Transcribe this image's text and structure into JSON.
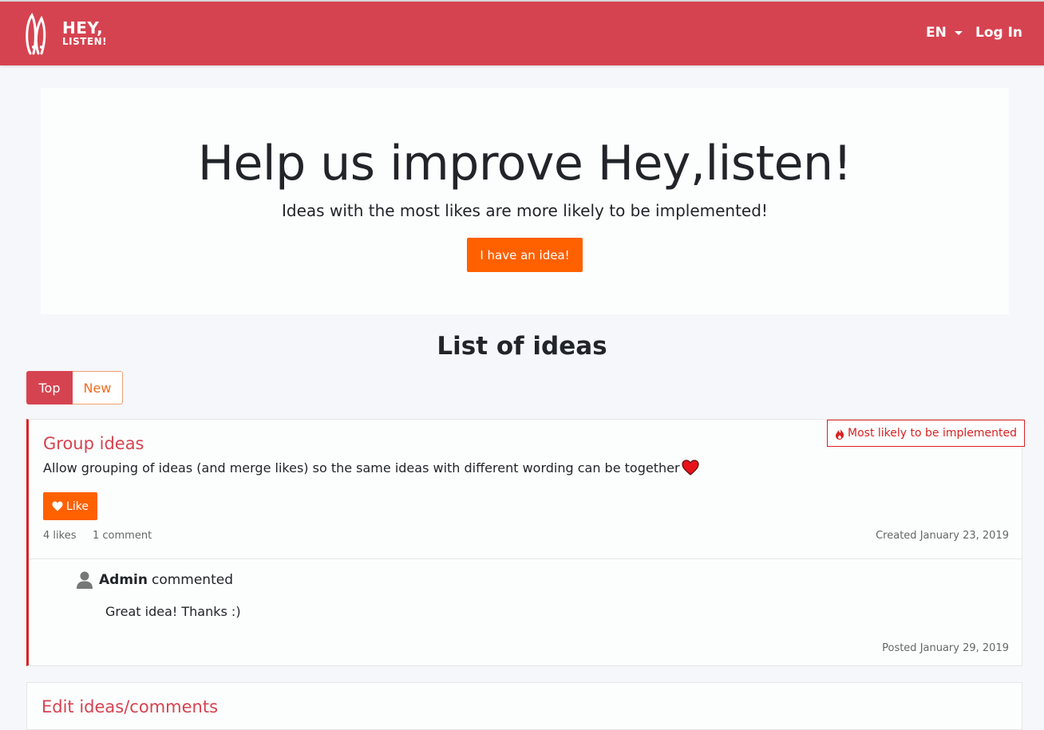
{
  "navbar": {
    "logo_line1": "HEY,",
    "logo_line2": "LISTEN!",
    "language": "EN",
    "login": "Log In",
    "bg_color": "#d64350"
  },
  "hero": {
    "title": "Help us improve Hey,listen!",
    "subtitle": "Ideas with the most likes are more likely to be implemented!",
    "cta": "I have an idea!"
  },
  "list": {
    "title": "List of ideas",
    "tabs": [
      {
        "label": "Top",
        "active": true
      },
      {
        "label": "New",
        "active": false
      }
    ]
  },
  "ideas": [
    {
      "badge": "Most likely to be implemented",
      "title": "Group ideas",
      "description": "Allow grouping of ideas (and merge likes) so the same ideas with different wording can be together",
      "description_emoji": "heart",
      "like_label": "Like",
      "likes": "4 likes",
      "comments": "1 comment",
      "created": "Created January 23, 2019",
      "comment": {
        "author": "Admin",
        "action": "commented",
        "body": "Great idea! Thanks :)",
        "posted": "Posted January 29, 2019"
      }
    },
    {
      "title": "Edit ideas/comments"
    }
  ],
  "colors": {
    "accent": "#d64350",
    "orange": "#ff6000",
    "badge_red": "#d92121"
  },
  "icons": [
    "logo-icon",
    "caret-down-icon",
    "flame-icon",
    "heart-icon",
    "user-icon"
  ]
}
